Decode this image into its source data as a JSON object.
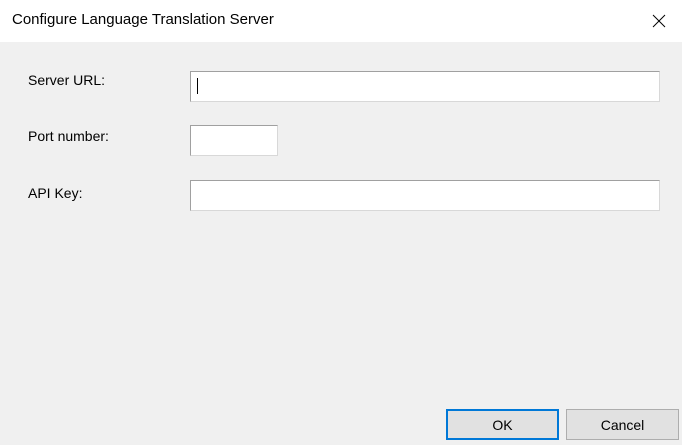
{
  "window": {
    "title": "Configure Language Translation Server",
    "close_icon": "close-icon"
  },
  "form": {
    "server_url_label": "Server URL:",
    "server_url_value": "",
    "port_label": "Port number:",
    "port_value": "",
    "api_key_label": "API Key:",
    "api_key_value": ""
  },
  "buttons": {
    "ok_label": "OK",
    "cancel_label": "Cancel"
  }
}
